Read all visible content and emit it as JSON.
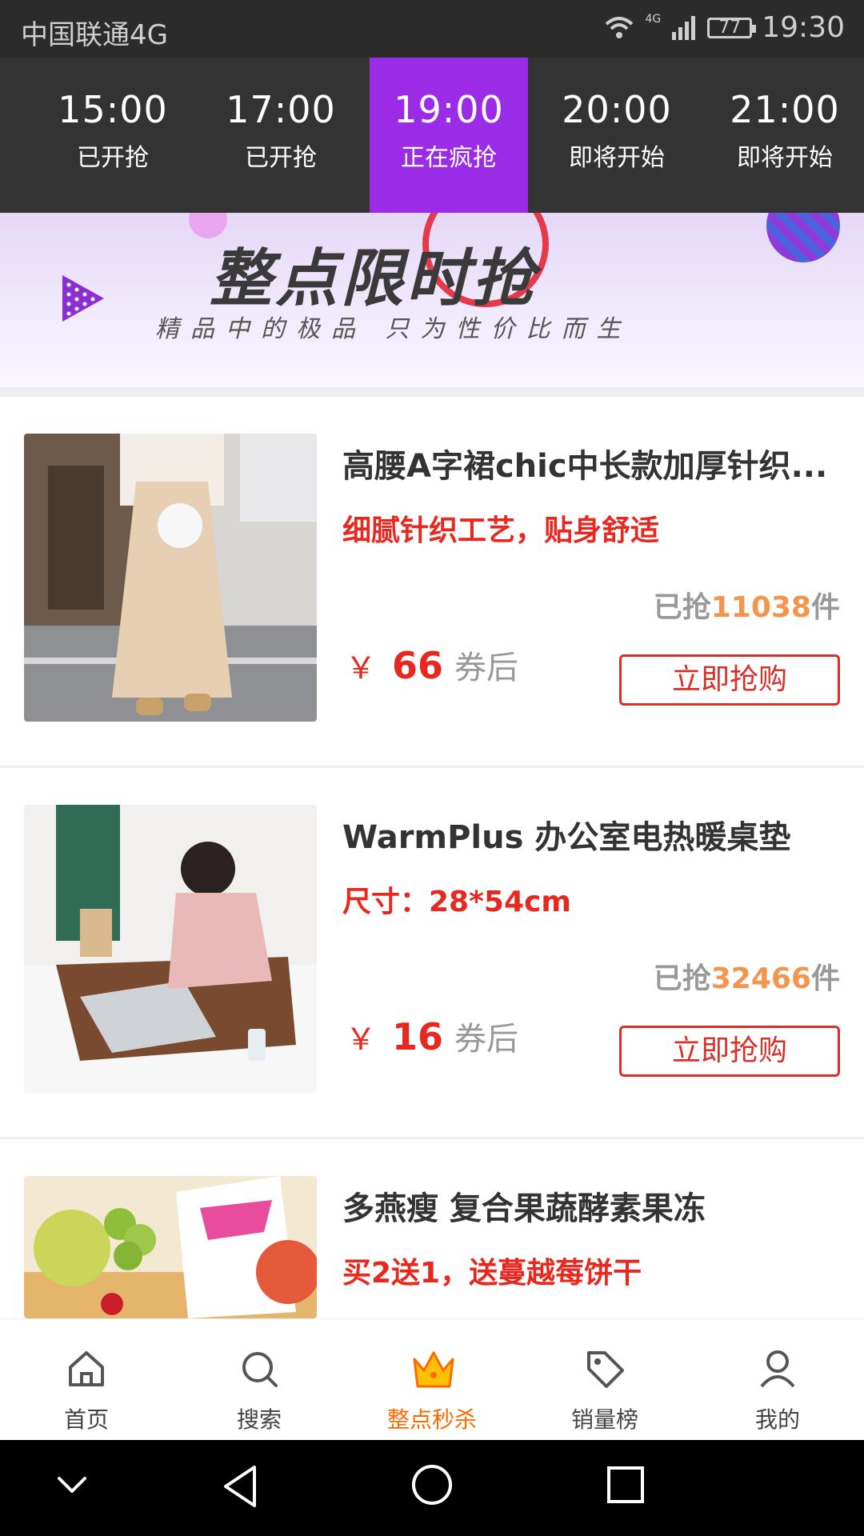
{
  "status_bar": {
    "carrier": "中国联通4G",
    "network": "4G",
    "battery": "77",
    "time": "19:30"
  },
  "time_tabs": [
    {
      "time": "15:00",
      "status": "已开抢"
    },
    {
      "time": "17:00",
      "status": "已开抢"
    },
    {
      "time": "19:00",
      "status": "正在疯抢",
      "active": true
    },
    {
      "time": "20:00",
      "status": "即将开始"
    },
    {
      "time": "21:00",
      "status": "即将开始"
    }
  ],
  "banner": {
    "title": "整点限时抢",
    "subtitle": "精品中的极品  只为性价比而生"
  },
  "products": [
    {
      "title": "高腰A字裙chic中长款加厚针织...",
      "tagline": "细腻针织工艺，贴身舒适",
      "sold_prefix": "已抢",
      "sold_count": "11038",
      "sold_suffix": "件",
      "currency": "￥",
      "price": "66",
      "price_note": "券后",
      "button": "立即抢购"
    },
    {
      "title": "WarmPlus 办公室电热暖桌垫",
      "tagline": "尺寸：28*54cm",
      "sold_prefix": "已抢",
      "sold_count": "32466",
      "sold_suffix": "件",
      "currency": "￥",
      "price": "16",
      "price_note": "券后",
      "button": "立即抢购"
    },
    {
      "title": "多燕瘦 复合果蔬酵素果冻",
      "tagline": "买2送1，送蔓越莓饼干"
    }
  ],
  "bottom_nav": [
    {
      "label": "首页",
      "icon": "home-icon"
    },
    {
      "label": "搜索",
      "icon": "search-icon"
    },
    {
      "label": "整点秒杀",
      "icon": "crown-icon",
      "active": true
    },
    {
      "label": "销量榜",
      "icon": "tag-icon"
    },
    {
      "label": "我的",
      "icon": "user-icon"
    }
  ],
  "colors": {
    "active_tab": "#9a2ce8",
    "accent_red": "#e8281f",
    "sold_orange": "#f5944d",
    "nav_active": "#ff6a00"
  }
}
